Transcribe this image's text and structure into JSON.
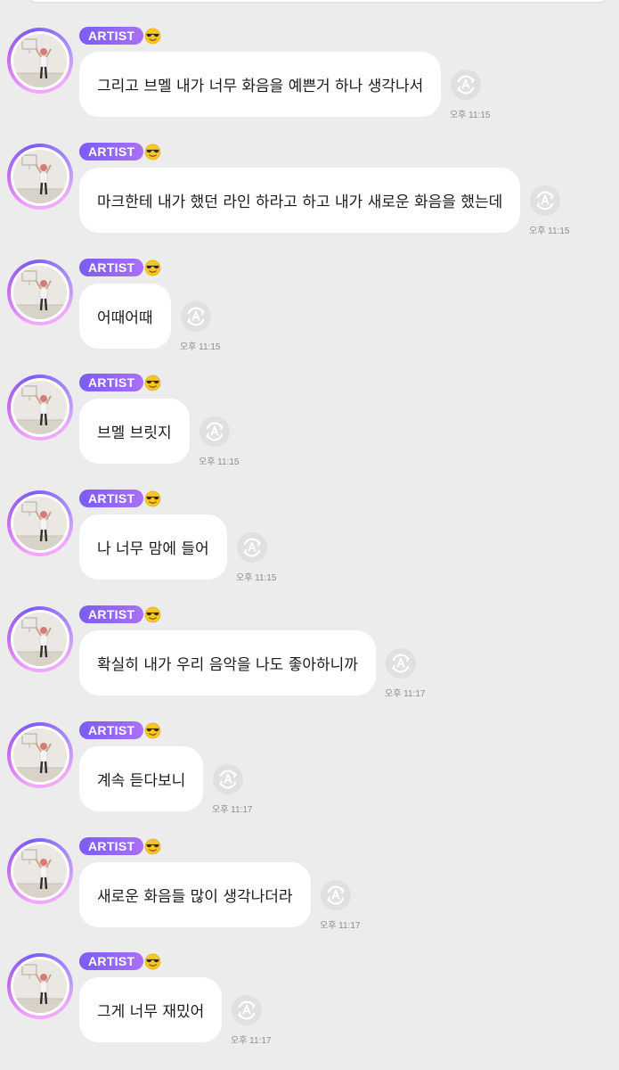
{
  "badge_label": "ARTIST",
  "colors": {
    "background": "#ececec",
    "bubble": "#ffffff",
    "badge_gradient_start": "#7b5cf5",
    "badge_gradient_end": "#a970f7",
    "time_text": "#8e8e8e"
  },
  "icons": {
    "badge_emoji": "sunglasses-emoji-icon",
    "translate": "translate-icon"
  },
  "messages": [
    {
      "text": "그리고 브멜 내가 너무 화음을 예쁜거 하나 생각나서",
      "time": "오후 11:15"
    },
    {
      "text": "마크한테 내가 했던 라인 하라고 하고 내가 새로운 화음을 했는데",
      "time": "오후 11:15"
    },
    {
      "text": "어때어때",
      "time": "오후 11:15"
    },
    {
      "text": "브멜 브릿지",
      "time": "오후 11:15"
    },
    {
      "text": "나 너무 맘에 들어",
      "time": "오후 11:15"
    },
    {
      "text": "확실히 내가 우리 음악을 나도 좋아하니까",
      "time": "오후 11:17"
    },
    {
      "text": "계속 듣다보니",
      "time": "오후 11:17"
    },
    {
      "text": "새로운 화음들 많이 생각나더라",
      "time": "오후 11:17"
    },
    {
      "text": "그게 너무 재밌어",
      "time": "오후 11:17"
    }
  ]
}
